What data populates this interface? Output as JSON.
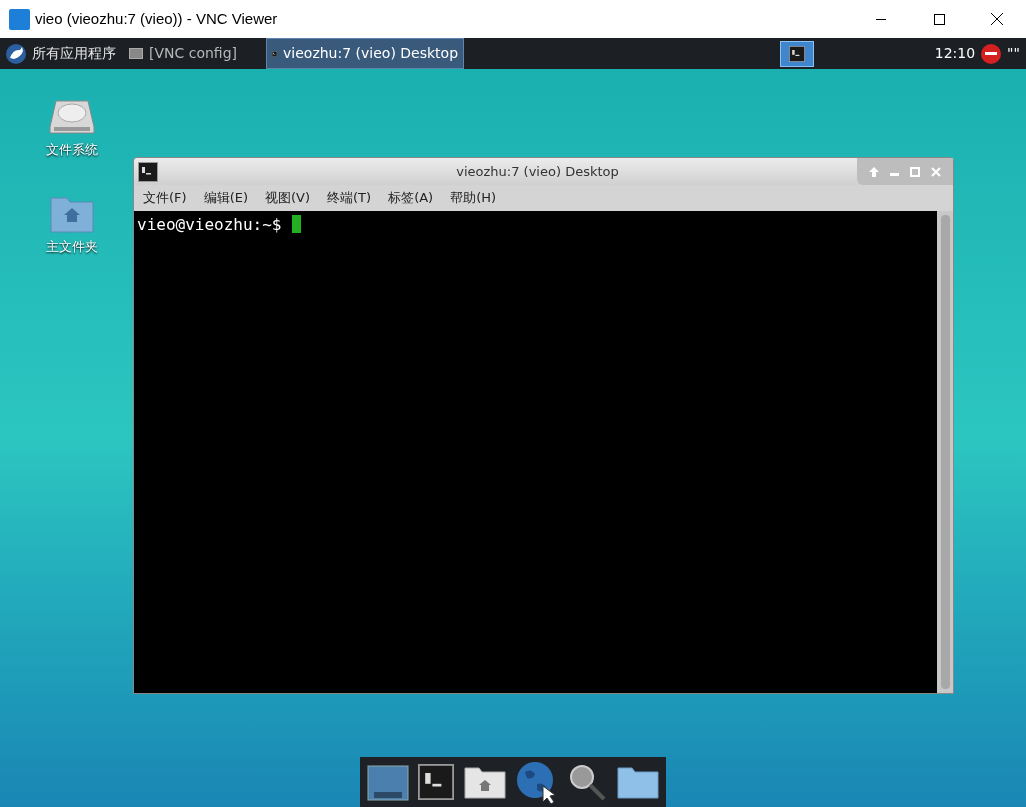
{
  "window": {
    "title": "vieo (vieozhu:7 (vieo)) - VNC Viewer"
  },
  "panel": {
    "menu_label": "所有应用程序",
    "tasks": [
      {
        "label": "[VNC config]",
        "selected": false
      },
      {
        "label": "vieozhu:7 (vieo) Desktop",
        "selected": true
      }
    ],
    "clock": "12:10",
    "tray_text": "\"\""
  },
  "desktop_icons": [
    {
      "kind": "drive",
      "label": "文件系统"
    },
    {
      "kind": "home",
      "label": "主文件夹"
    }
  ],
  "terminal": {
    "title": "vieozhu:7 (vieo) Desktop",
    "menu": [
      "文件(F)",
      "编辑(E)",
      "视图(V)",
      "终端(T)",
      "标签(A)",
      "帮助(H)"
    ],
    "prompt": "vieo@vieozhu:~$"
  },
  "dock": [
    {
      "kind": "screen"
    },
    {
      "kind": "terminal"
    },
    {
      "kind": "home"
    },
    {
      "kind": "globe"
    },
    {
      "kind": "search"
    },
    {
      "kind": "folder"
    }
  ]
}
